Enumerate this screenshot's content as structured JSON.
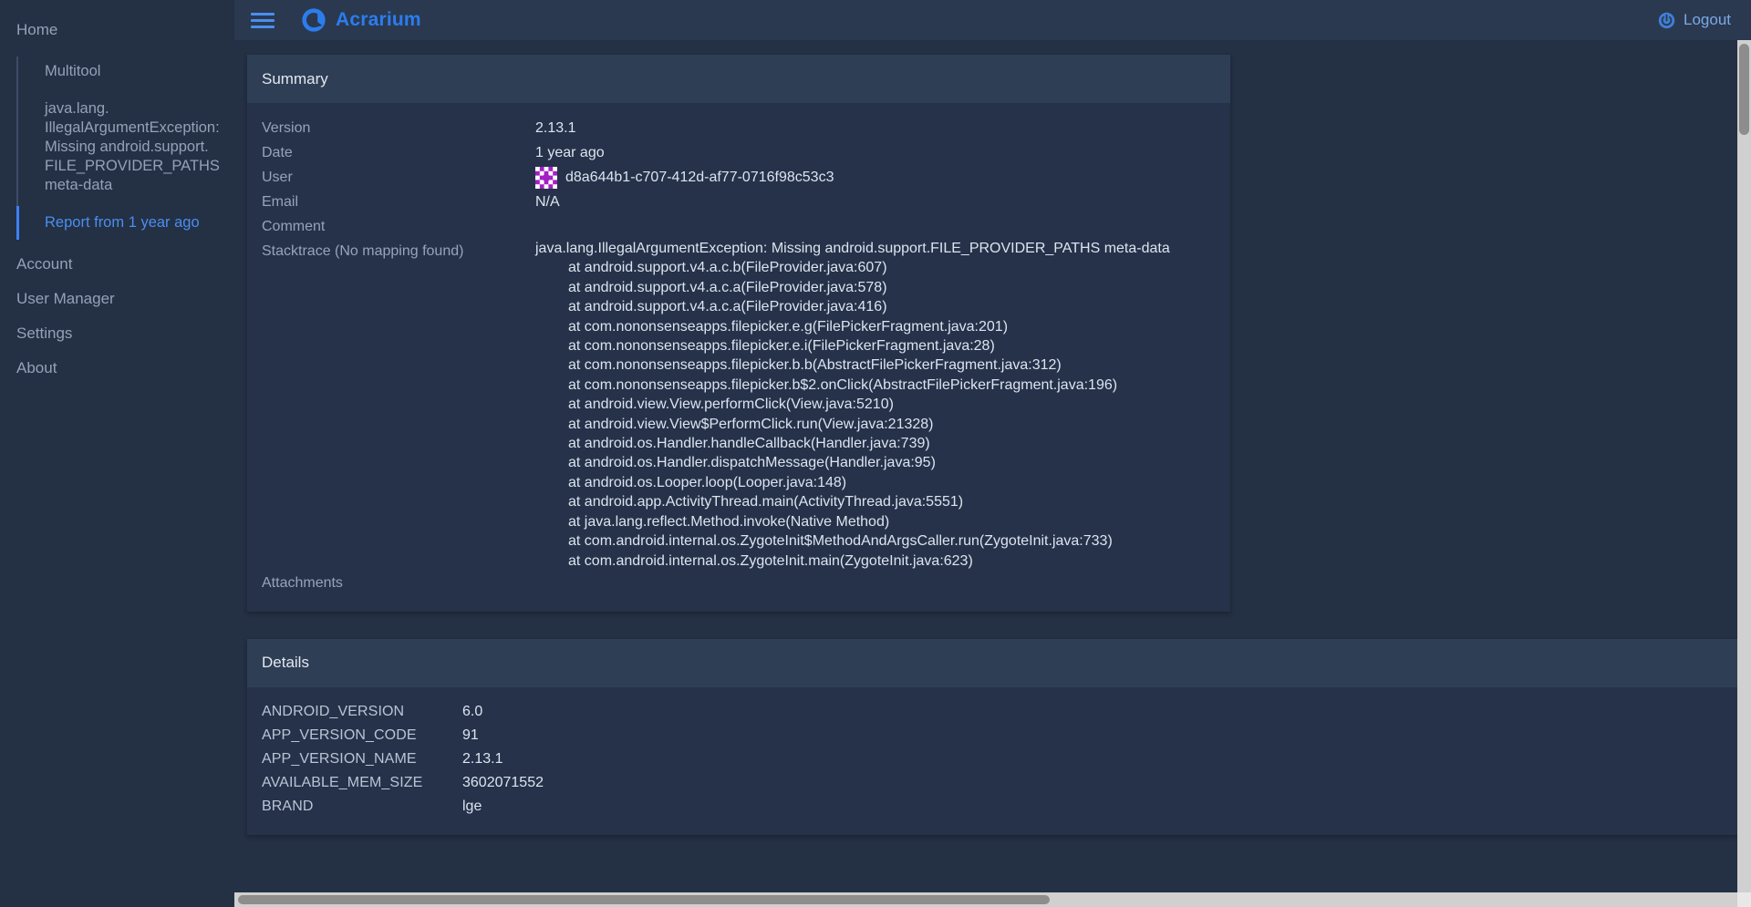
{
  "header": {
    "menu_icon": "hamburger-icon",
    "brand": "Acrarium",
    "logo_icon": "acrarium-logo-icon",
    "logout_label": "Logout",
    "logout_icon": "power-icon"
  },
  "sidebar": {
    "home": "Home",
    "items": [
      {
        "label": "Multitool",
        "active": false
      },
      {
        "label": "java.lang. IllegalArgumentException: Missing android.support. FILE_PROVIDER_PATHS meta-data",
        "active": false
      },
      {
        "label": "Report from 1 year ago",
        "active": true
      }
    ],
    "sub_line1": "java.lang.",
    "sub_line2": "IllegalArgumentException:",
    "sub_line3": "Missing android.support.",
    "sub_line4": "FILE_PROVIDER_PATHS",
    "sub_line5": "meta-data",
    "bottom_items": [
      {
        "label": "Account"
      },
      {
        "label": "User Manager"
      },
      {
        "label": "Settings"
      },
      {
        "label": "About"
      }
    ]
  },
  "summary": {
    "title": "Summary",
    "fields": [
      {
        "label": "Version",
        "value": "2.13.1"
      },
      {
        "label": "Date",
        "value": "1 year ago"
      },
      {
        "label": "User",
        "value": "d8a644b1-c707-412d-af77-0716f98c53c3"
      },
      {
        "label": "Email",
        "value": "N/A"
      },
      {
        "label": "Comment",
        "value": ""
      }
    ],
    "version_label": "Version",
    "version_value": "2.13.1",
    "date_label": "Date",
    "date_value": "1 year ago",
    "user_label": "User",
    "user_value": "d8a644b1-c707-412d-af77-0716f98c53c3",
    "email_label": "Email",
    "email_value": "N/A",
    "comment_label": "Comment",
    "comment_value": "",
    "stacktrace_label": "Stacktrace (No mapping found)",
    "stacktrace_head": "java.lang.IllegalArgumentException: Missing android.support.FILE_PROVIDER_PATHS meta-data",
    "stacktrace_lines": [
      "at android.support.v4.a.c.b(FileProvider.java:607)",
      "at android.support.v4.a.c.a(FileProvider.java:578)",
      "at android.support.v4.a.c.a(FileProvider.java:416)",
      "at com.nononsenseapps.filepicker.e.g(FilePickerFragment.java:201)",
      "at com.nononsenseapps.filepicker.e.i(FilePickerFragment.java:28)",
      "at com.nononsenseapps.filepicker.b.b(AbstractFilePickerFragment.java:312)",
      "at com.nononsenseapps.filepicker.b$2.onClick(AbstractFilePickerFragment.java:196)",
      "at android.view.View.performClick(View.java:5210)",
      "at android.view.View$PerformClick.run(View.java:21328)",
      "at android.os.Handler.handleCallback(Handler.java:739)",
      "at android.os.Handler.dispatchMessage(Handler.java:95)",
      "at android.os.Looper.loop(Looper.java:148)",
      "at android.app.ActivityThread.main(ActivityThread.java:5551)",
      "at java.lang.reflect.Method.invoke(Native Method)",
      "at com.android.internal.os.ZygoteInit$MethodAndArgsCaller.run(ZygoteInit.java:733)",
      "at com.android.internal.os.ZygoteInit.main(ZygoteInit.java:623)"
    ],
    "attachments_label": "Attachments",
    "attachments_value": ""
  },
  "details": {
    "title": "Details",
    "rows": [
      {
        "key": "ANDROID_VERSION",
        "value": "6.0"
      },
      {
        "key": "APP_VERSION_CODE",
        "value": "91"
      },
      {
        "key": "APP_VERSION_NAME",
        "value": "2.13.1"
      },
      {
        "key": "AVAILABLE_MEM_SIZE",
        "value": "3602071552"
      },
      {
        "key": "BRAND",
        "value": "lge"
      }
    ]
  },
  "colors": {
    "page_bg": "#243044",
    "sidebar_bg": "#243044",
    "header_bg": "#2a394f",
    "card_bg": "#25324a",
    "card_head_bg": "#2e3e54",
    "accent_blue": "#3b82f6",
    "brand_blue": "#2b7def",
    "text_primary": "#dce4ef",
    "text_muted": "#96a4b9",
    "identicon_purple": "#a41fc4",
    "scrollbar_track": "#d0d0d0",
    "scrollbar_thumb": "#8d8d8d"
  }
}
